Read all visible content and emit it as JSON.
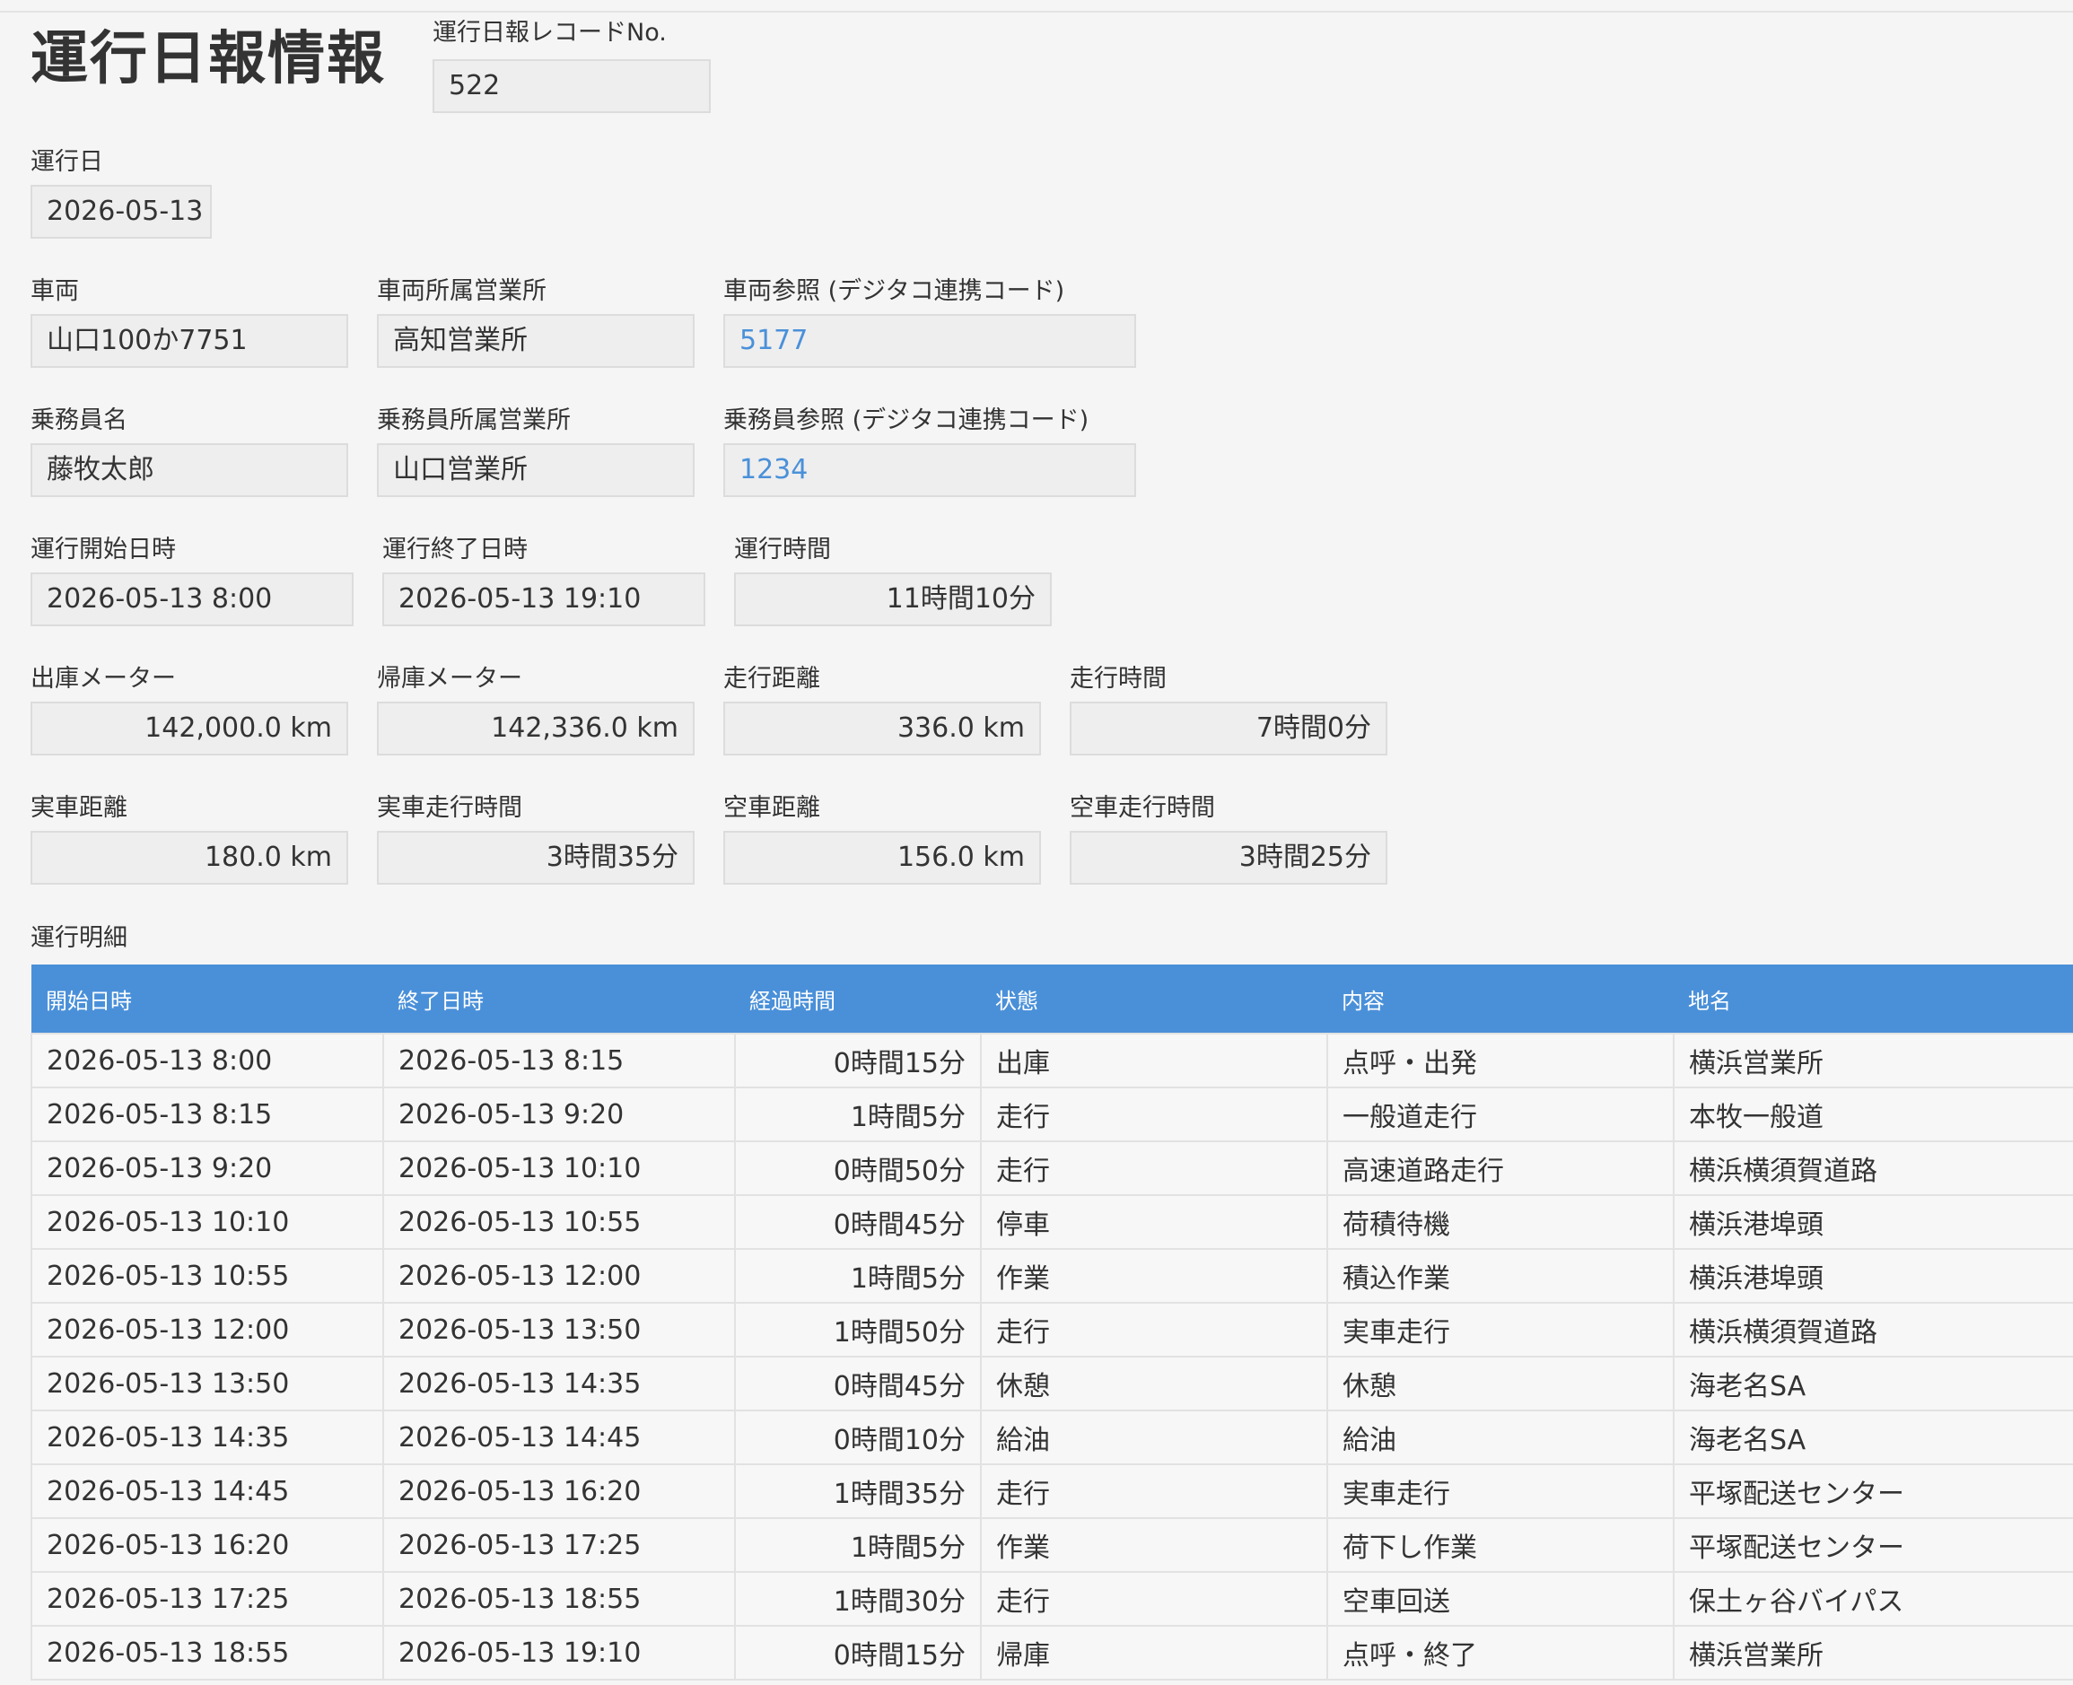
{
  "page": {
    "title": "運行日報情報"
  },
  "record_no": {
    "label": "運行日報レコードNo.",
    "value": "522"
  },
  "operation_date": {
    "label": "運行日",
    "value": "2026-05-13"
  },
  "vehicle": {
    "label": "車両",
    "value": "山口100か7751"
  },
  "vehicle_office": {
    "label": "車両所属営業所",
    "value": "高知営業所"
  },
  "vehicle_ref": {
    "label": "車両参照 (デジタコ連携コード)",
    "value": "5177"
  },
  "driver": {
    "label": "乗務員名",
    "value": "藤牧太郎"
  },
  "driver_office": {
    "label": "乗務員所属営業所",
    "value": "山口営業所"
  },
  "driver_ref": {
    "label": "乗務員参照 (デジタコ連携コード)",
    "value": "1234"
  },
  "start_datetime": {
    "label": "運行開始日時",
    "value": "2026-05-13 8:00"
  },
  "end_datetime": {
    "label": "運行終了日時",
    "value": "2026-05-13 19:10"
  },
  "operation_time": {
    "label": "運行時間",
    "value": "11時間10分"
  },
  "departure_meter": {
    "label": "出庫メーター",
    "value": "142,000.0 km"
  },
  "return_meter": {
    "label": "帰庫メーター",
    "value": "142,336.0 km"
  },
  "travel_distance": {
    "label": "走行距離",
    "value": "336.0 km"
  },
  "travel_time": {
    "label": "走行時間",
    "value": "7時間0分"
  },
  "loaded_distance": {
    "label": "実車距離",
    "value": "180.0 km"
  },
  "loaded_travel_time": {
    "label": "実車走行時間",
    "value": "3時間35分"
  },
  "empty_distance": {
    "label": "空車距離",
    "value": "156.0 km"
  },
  "empty_travel_time": {
    "label": "空車走行時間",
    "value": "3時間25分"
  },
  "details": {
    "label": "運行明細",
    "columns": [
      "開始日時",
      "終了日時",
      "経過時間",
      "状態",
      "内容",
      "地名"
    ],
    "rows": [
      [
        "2026-05-13 8:00",
        "2026-05-13 8:15",
        "0時間15分",
        "出庫",
        "点呼・出発",
        "横浜営業所"
      ],
      [
        "2026-05-13 8:15",
        "2026-05-13 9:20",
        "1時間5分",
        "走行",
        "一般道走行",
        "本牧一般道"
      ],
      [
        "2026-05-13 9:20",
        "2026-05-13 10:10",
        "0時間50分",
        "走行",
        "高速道路走行",
        "横浜横須賀道路"
      ],
      [
        "2026-05-13 10:10",
        "2026-05-13 10:55",
        "0時間45分",
        "停車",
        "荷積待機",
        "横浜港埠頭"
      ],
      [
        "2026-05-13 10:55",
        "2026-05-13 12:00",
        "1時間5分",
        "作業",
        "積込作業",
        "横浜港埠頭"
      ],
      [
        "2026-05-13 12:00",
        "2026-05-13 13:50",
        "1時間50分",
        "走行",
        "実車走行",
        "横浜横須賀道路"
      ],
      [
        "2026-05-13 13:50",
        "2026-05-13 14:35",
        "0時間45分",
        "休憩",
        "休憩",
        "海老名SA"
      ],
      [
        "2026-05-13 14:35",
        "2026-05-13 14:45",
        "0時間10分",
        "給油",
        "給油",
        "海老名SA"
      ],
      [
        "2026-05-13 14:45",
        "2026-05-13 16:20",
        "1時間35分",
        "走行",
        "実車走行",
        "平塚配送センター"
      ],
      [
        "2026-05-13 16:20",
        "2026-05-13 17:25",
        "1時間5分",
        "作業",
        "荷下し作業",
        "平塚配送センター"
      ],
      [
        "2026-05-13 17:25",
        "2026-05-13 18:55",
        "1時間30分",
        "走行",
        "空車回送",
        "保土ヶ谷バイパス"
      ],
      [
        "2026-05-13 18:55",
        "2026-05-13 19:10",
        "0時間15分",
        "帰庫",
        "点呼・終了",
        "横浜営業所"
      ]
    ]
  },
  "colors": {
    "header_bg": "#4a90d9",
    "link": "#4a90d9",
    "page_bg": "#f5f5f5"
  }
}
